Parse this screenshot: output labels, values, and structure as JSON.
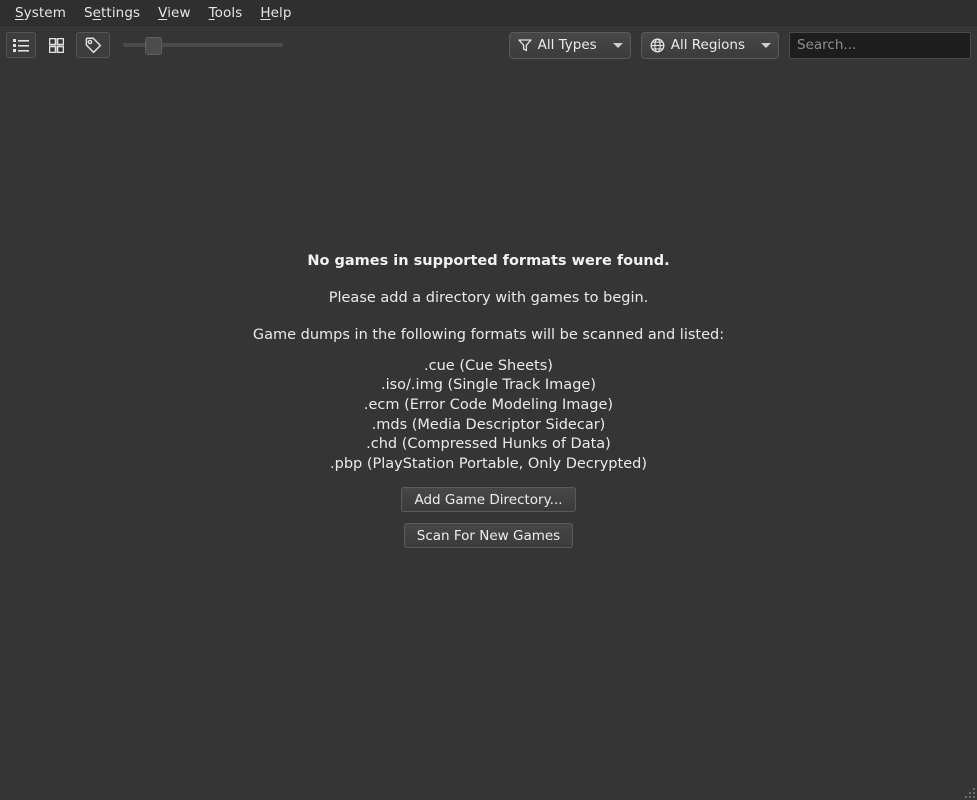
{
  "window": {
    "background": "#353535",
    "text_color": "#eaeaea"
  },
  "menubar": {
    "items": [
      {
        "label": "System",
        "mnemonic": "S",
        "pre": "",
        "post": "ystem"
      },
      {
        "label": "Settings",
        "mnemonic": "e",
        "pre": "S",
        "post": "ttings"
      },
      {
        "label": "View",
        "mnemonic": "V",
        "pre": "",
        "post": "iew"
      },
      {
        "label": "Tools",
        "mnemonic": "T",
        "pre": "",
        "post": "ools"
      },
      {
        "label": "Help",
        "mnemonic": "H",
        "pre": "",
        "post": "elp"
      }
    ]
  },
  "toolbar": {
    "buttons": [
      {
        "name": "list-view-icon",
        "tooltip": "Game List",
        "checked": true
      },
      {
        "name": "grid-view-icon",
        "tooltip": "Game Grid",
        "checked": false
      },
      {
        "name": "tag-icon",
        "tooltip": "Show Titles",
        "checked": true
      }
    ],
    "zoom_slider": {
      "value": 14,
      "min": 0,
      "max": 100
    },
    "type_filter": {
      "label": "All Types",
      "icon": "filter-funnel-icon"
    },
    "region_filter": {
      "label": "All Regions",
      "icon": "globe-icon"
    },
    "search": {
      "value": "",
      "placeholder": "Search..."
    }
  },
  "empty_state": {
    "title": "No games in supported formats were found.",
    "subtitle": "Please add a directory with games to begin.",
    "formats_header": "Game dumps in the following formats will be scanned and listed:",
    "formats": [
      ".cue (Cue Sheets)",
      ".iso/.img (Single Track Image)",
      ".ecm (Error Code Modeling Image)",
      ".mds (Media Descriptor Sidecar)",
      ".chd (Compressed Hunks of Data)",
      ".pbp (PlayStation Portable, Only Decrypted)"
    ],
    "add_directory_button": "Add Game Directory...",
    "scan_button": "Scan For New Games"
  }
}
